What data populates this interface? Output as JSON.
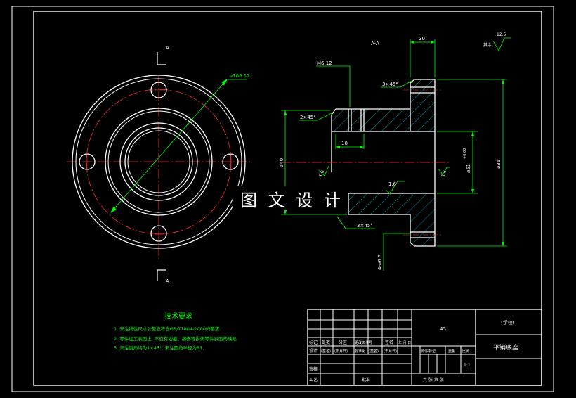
{
  "colors": {
    "background": "#000000",
    "outline": "#ffffff",
    "dimension": "#00ff00",
    "centerline": "#ff0000",
    "hatch": "#00ffff",
    "note_text": "#00ff00",
    "title_yellow": "#ffff00"
  },
  "section_label_top": "A",
  "section_label_bottom": "A",
  "section_view_title": "A-A",
  "watermark": "图 文 设 计",
  "dimensions": {
    "bolt_circle": "⌀106.12",
    "thread": "M6.12",
    "width_top": "20",
    "chamfer_top": "3×45°",
    "chamfer_left": "2×45°",
    "length_10": "10",
    "dia_left": "⌀40",
    "bore": "⌀51",
    "bore_tol": "+0.03",
    "dia_outer": "⌀86",
    "rough_16": "1.6",
    "rough_left": "1.6",
    "rough_right": "1.6",
    "chamfer_bottom": "3×45°",
    "holes": "4-⌀6.5",
    "rough_general_value": "12.5",
    "rough_general_label": "其余"
  },
  "notes": {
    "heading": "技术要求",
    "items": [
      "1. 未注线性尺寸公差应符合GB/T1804-2000的要求.",
      "2. 零件加工表面上, 不应有划痕、擦伤等损伤零件表面的缺陷.",
      "3. 未注倒角均为1×45°, 未注圆角半径为R1."
    ]
  },
  "title_block": {
    "material": "45",
    "school": "(学校)",
    "part_name": "平销底座",
    "scale": "1:1",
    "h_mark": "标记",
    "h_count": "处数",
    "h_zone": "分区",
    "h_docno": "更改文件号",
    "h_sign": "签名",
    "h_date": "年.月.日",
    "h_design": "设计",
    "v_sign1": "(签名)",
    "v_date1": "(年月日)",
    "h_std": "标准化",
    "v_sign2": "(签名)",
    "v_date2": "(年月日)",
    "h_stage": "阶段标记",
    "h_weight": "重量",
    "h_ratio": "比例",
    "h_check": "审核",
    "h_process": "工艺",
    "h_approve": "批准",
    "sheet_text": "共 张 第 张"
  }
}
